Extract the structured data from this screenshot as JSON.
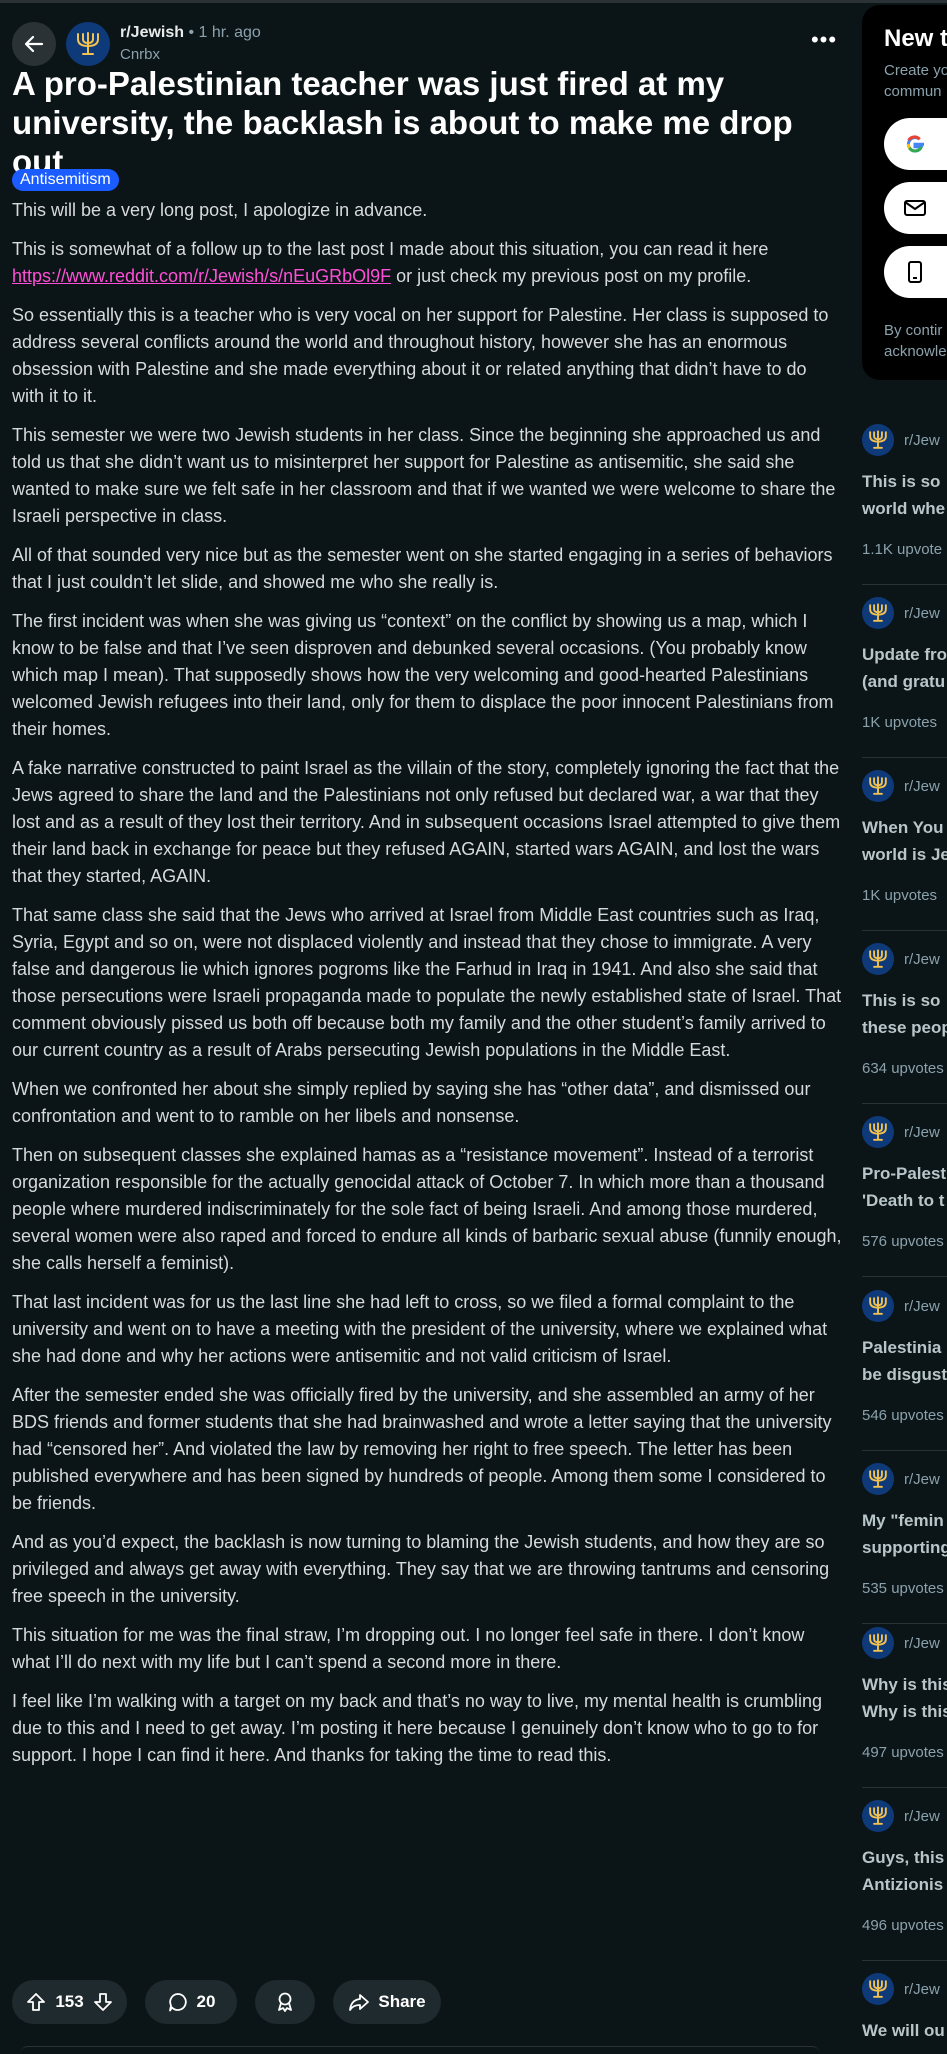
{
  "post": {
    "subreddit": "r/Jewish",
    "separator": "•",
    "time": "1 hr. ago",
    "author": "Cnrbx",
    "title": "A pro-Palestinian teacher was just fired at my university, the backlash is about to make me drop out",
    "flair": "Antisemitism",
    "body": [
      "This will be a very long post, I apologize in advance.",
      "This is somewhat of a follow up to the last post I made about this situation, you can read it here",
      "So essentially this is a teacher who is very vocal on her support for Palestine. Her class is supposed to address several conflicts around the world and throughout history, however she has an enormous obsession with Palestine and she made everything about it or related anything that didn’t have to do with it to it.",
      "This semester we were two Jewish students in her class. Since the beginning she approached us and told us that she didn’t want us to misinterpret her support for Palestine as antisemitic, she said she wanted to make sure we felt safe in her classroom and that if we wanted we were welcome to share the Israeli perspective in class.",
      "All of that sounded very nice but as the semester went on she started engaging in a series of behaviors that I just couldn’t let slide, and showed me who she really is.",
      "The first incident was when she was giving us “context” on the conflict by showing us a map, which I know to be false and that I’ve seen disproven and debunked several occasions. (You probably know which map I mean). That supposedly shows how the very welcoming and good-hearted Palestinians welcomed Jewish refugees into their land, only for them to displace the poor innocent Palestinians from their homes.",
      "A fake narrative constructed to paint Israel as the villain of the story, completely ignoring the fact that the Jews agreed to share the land and the Palestinians not only refused but declared war, a war that they lost and as a result of they lost their territory. And in subsequent occasions Israel attempted to give them their land back in exchange for peace but they refused AGAIN, started wars AGAIN, and lost the wars that they started, AGAIN.",
      "That same class she said that the Jews who arrived at Israel from Middle East countries such as Iraq, Syria, Egypt and so on, were not displaced violently and instead that they chose to immigrate. A very false and dangerous lie which ignores pogroms like the Farhud in Iraq in 1941. And also she said that those persecutions were Israeli propaganda made to populate the newly established state of Israel. That comment obviously pissed us both off because both my family and the other student’s family arrived to our current country as a result of Arabs persecuting Jewish populations in the Middle East.",
      "When we confronted her about she simply replied by saying she has “other data”, and dismissed our confrontation and went to to ramble on her libels and nonsense.",
      "Then on subsequent classes she explained hamas as a “resistance movement”. Instead of a terrorist organization responsible for the actually genocidal attack of October 7. In which more than a thousand people where murdered indiscriminately for the sole fact of being Israeli. And among those murdered, several women were also raped and forced to endure all kinds of barbaric sexual abuse (funnily enough, she calls herself a feminist).",
      "That last incident was for us the last line she had left to cross, so we filed a formal complaint to the university and went on to have a meeting with the president of the university, where we explained what she had done and why her actions were antisemitic and not valid criticism of Israel.",
      "After the semester ended she was officially fired by the university, and she assembled an army of her BDS friends and former students that she had brainwashed and wrote a letter saying that the university had “censored her”. And violated the law by removing her right to free speech. The letter has been published everywhere and has been signed by hundreds of people. Among them some I considered to be friends.",
      "And as you’d expect, the backlash is now turning to blaming the Jewish students, and how they are so privileged and always get away with everything. They say that we are throwing tantrums and censoring free speech in the university.",
      "This situation for me was the final straw, I’m dropping out. I no longer feel safe in there. I don’t know what I’ll do next with my life but I can’t spend a second more in there.",
      "I feel like I’m walking with a target on my back and that’s no way to live, my mental health is crumbling due to this and I need to get away. I’m posting it here because I genuinely don’t know who to go to for support. I hope I can find it here. And thanks for taking the time to read this."
    ],
    "link_text": "https://www.reddit.com/r/Jewish/s/nEuGRbOl9F",
    "link_suffix": "or just check my previous post on my profile.",
    "upvotes": "153",
    "comments": "20",
    "share_label": "Share"
  },
  "sidebar": {
    "signup_title": "New t",
    "signup_desc": [
      "Create yo",
      "commun"
    ],
    "signup_fine": [
      "By contir",
      "acknowle"
    ],
    "related": [
      {
        "sub": "r/Jew",
        "title": [
          "This is so",
          "world whe"
        ],
        "upvotes": "1.1K upvote"
      },
      {
        "sub": "r/Jew",
        "title": [
          "Update fro",
          "(and gratu"
        ],
        "upvotes": "1K upvotes"
      },
      {
        "sub": "r/Jew",
        "title": [
          "When You",
          "world is Je"
        ],
        "upvotes": "1K upvotes"
      },
      {
        "sub": "r/Jew",
        "title": [
          "This is so",
          "these peop"
        ],
        "upvotes": "634 upvotes"
      },
      {
        "sub": "r/Jew",
        "title": [
          "Pro-Palest",
          "'Death to t"
        ],
        "upvotes": "576 upvotes"
      },
      {
        "sub": "r/Jew",
        "title": [
          "Palestinia",
          "be disgust"
        ],
        "upvotes": "546 upvotes"
      },
      {
        "sub": "r/Jew",
        "title": [
          "My \"femin",
          "supporting"
        ],
        "upvotes": "535 upvotes"
      },
      {
        "sub": "r/Jew",
        "title": [
          "Why is this",
          "Why is this"
        ],
        "upvotes": "497 upvotes"
      },
      {
        "sub": "r/Jew",
        "title": [
          "Guys, this",
          "Antizionis"
        ],
        "upvotes": "496 upvotes"
      },
      {
        "sub": "r/Jew",
        "title": [
          "We will ou",
          ""
        ],
        "upvotes": ""
      }
    ]
  },
  "colors": {
    "background": "#0b1416",
    "flair": "#1a5cff",
    "link": "#ff4fd8",
    "subreddit_icon": "#0f3a7a",
    "menorah": "#f2c14e"
  },
  "icons": [
    "back-arrow-icon",
    "menorah-icon",
    "more-icon",
    "upvote-icon",
    "downvote-icon",
    "comment-icon",
    "award-icon",
    "share-icon",
    "google-icon",
    "mail-icon",
    "phone-icon"
  ]
}
